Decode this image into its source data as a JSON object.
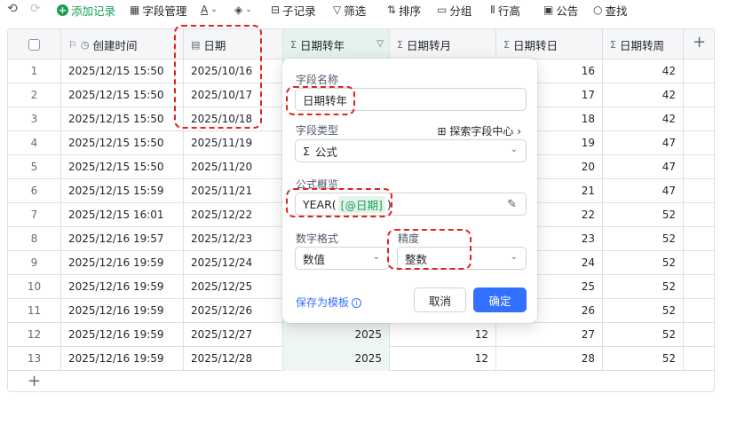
{
  "toolbar": {
    "add_record": "添加记录",
    "field_manage": "字段管理",
    "sub_record": "子记录",
    "filter": "筛选",
    "sort": "排序",
    "group": "分组",
    "row_height": "行高",
    "announce": "公告",
    "find": "查找"
  },
  "table": {
    "headers": {
      "created": "创建时间",
      "date": "日期",
      "year": "日期转年",
      "month": "日期转月",
      "day": "日期转日",
      "week": "日期转周"
    },
    "rows": [
      {
        "i": "1",
        "created": "2025/12/15 15:50",
        "date": "2025/10/16",
        "year": "",
        "month": "",
        "day": "16",
        "week": "42"
      },
      {
        "i": "2",
        "created": "2025/12/15 15:50",
        "date": "2025/10/17",
        "year": "",
        "month": "",
        "day": "17",
        "week": "42"
      },
      {
        "i": "3",
        "created": "2025/12/15 15:50",
        "date": "2025/10/18",
        "year": "",
        "month": "",
        "day": "18",
        "week": "42"
      },
      {
        "i": "4",
        "created": "2025/12/15 15:50",
        "date": "2025/11/19",
        "year": "",
        "month": "",
        "day": "19",
        "week": "47"
      },
      {
        "i": "5",
        "created": "2025/12/15 15:50",
        "date": "2025/11/20",
        "year": "",
        "month": "",
        "day": "20",
        "week": "47"
      },
      {
        "i": "6",
        "created": "2025/12/15 15:59",
        "date": "2025/11/21",
        "year": "",
        "month": "",
        "day": "21",
        "week": "47"
      },
      {
        "i": "7",
        "created": "2025/12/15 16:01",
        "date": "2025/12/22",
        "year": "",
        "month": "",
        "day": "22",
        "week": "52"
      },
      {
        "i": "8",
        "created": "2025/12/16 19:57",
        "date": "2025/12/23",
        "year": "",
        "month": "",
        "day": "23",
        "week": "52"
      },
      {
        "i": "9",
        "created": "2025/12/16 19:59",
        "date": "2025/12/24",
        "year": "",
        "month": "",
        "day": "24",
        "week": "52"
      },
      {
        "i": "10",
        "created": "2025/12/16 19:59",
        "date": "2025/12/25",
        "year": "",
        "month": "",
        "day": "25",
        "week": "52"
      },
      {
        "i": "11",
        "created": "2025/12/16 19:59",
        "date": "2025/12/26",
        "year": "",
        "month": "",
        "day": "26",
        "week": "52"
      },
      {
        "i": "12",
        "created": "2025/12/16 19:59",
        "date": "2025/12/27",
        "year": "2025",
        "month": "12",
        "day": "27",
        "week": "52"
      },
      {
        "i": "13",
        "created": "2025/12/16 19:59",
        "date": "2025/12/28",
        "year": "2025",
        "month": "12",
        "day": "28",
        "week": "52"
      }
    ]
  },
  "popup": {
    "field_name_label": "字段名称",
    "field_name_value": "日期转年",
    "field_type_label": "字段类型",
    "explore_link": "探索字段中心",
    "field_type_value": "公式",
    "formula_label": "公式概览",
    "formula_prefix": "YEAR(",
    "formula_ref": "[@日期]",
    "formula_suffix": ")",
    "number_format_label": "数字格式",
    "number_format_value": "数值",
    "precision_label": "精度",
    "precision_value": "整数",
    "save_template": "保存为模板",
    "cancel": "取消",
    "confirm": "确定"
  }
}
